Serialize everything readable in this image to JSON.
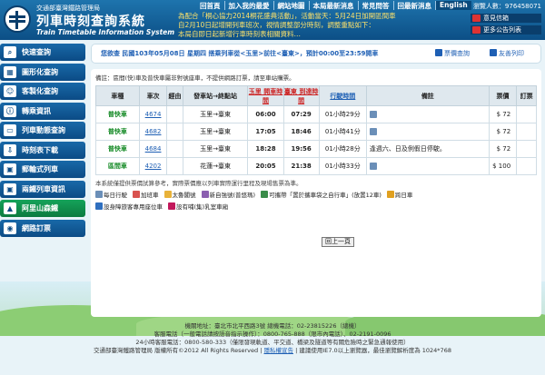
{
  "header": {
    "agency": "交通部臺灣鐵路管理局",
    "title_cn": "列車時刻查詢系統",
    "title_en": "Train Timetable Information System",
    "nav": [
      "回首頁",
      "加入我的最愛",
      "網站地圖",
      "本局最新消息",
      "常見問答",
      "回最新消息",
      "English"
    ],
    "visitor": "瀏覽人數：976458071",
    "marquee": [
      "為配合「桐心協力2014桐花盛典活動」，活動當天：5月24日加開區間車",
      "自2月10日起增開列車班次，視情調整部分時刻，調整重點如下：",
      "本局自即日起新增行車時刻表相關資料…"
    ],
    "side_buttons": [
      "意見信箱",
      "更多公告列表"
    ]
  },
  "sidebar": [
    {
      "icon": "search-icon",
      "label": "快速查詢"
    },
    {
      "icon": "chart-icon",
      "label": "圖形化查詢"
    },
    {
      "icon": "user-icon",
      "label": "客製化查詢"
    },
    {
      "icon": "info-icon",
      "label": "轉乘資訊"
    },
    {
      "icon": "monitor-icon",
      "label": "列車動態查詢"
    },
    {
      "icon": "download-icon",
      "label": "時刻表下載"
    },
    {
      "icon": "train-icon",
      "label": "郵輪式列車"
    },
    {
      "icon": "train-icon",
      "label": "兩鐵列車資訊"
    },
    {
      "icon": "mountain-icon",
      "label": "阿里山森鐵"
    },
    {
      "icon": "ticket-icon",
      "label": "網路訂票"
    }
  ],
  "info_bar": {
    "text": "您欲查 民國103年05月08日 星期四 搭乘列車從<玉里>前往<臺東>，預計00:00至23:59開車",
    "tool1": "票價查詢",
    "tool2": "友善列印"
  },
  "note": "備註：區間(快)車及普快車屬非對號座車，不提供網路訂票，請至車站購票。",
  "table": {
    "headers": [
      "車種",
      "車次",
      "經由",
      "發車站→終點站",
      "玉里 開車時間",
      "臺東 到達時間",
      "行駛時間",
      "備註",
      "票價",
      "訂票"
    ],
    "rows": [
      {
        "type": "普快車",
        "train": "4674",
        "route": "玉里→臺東",
        "dep": "06:00",
        "arr": "07:29",
        "dur": "01小時29分",
        "note": "",
        "price": "$ 72"
      },
      {
        "type": "普快車",
        "train": "4682",
        "route": "玉里→臺東",
        "dep": "17:05",
        "arr": "18:46",
        "dur": "01小時41分",
        "note": "",
        "price": "$ 72"
      },
      {
        "type": "普快車",
        "train": "4684",
        "route": "玉里→臺東",
        "dep": "18:28",
        "arr": "19:56",
        "dur": "01小時28分",
        "note": "逢週六、日及例假日停駛。",
        "price": "$ 72"
      },
      {
        "type": "區間車",
        "train": "4202",
        "route": "花蓮→臺東",
        "dep": "20:05",
        "arr": "21:38",
        "dur": "01小時33分",
        "note": "",
        "price": "$ 100"
      }
    ]
  },
  "legend_note": "本系統僅提供票價試算參考，實際票價應以列車實際運行里程及現場售票為準。",
  "legend": [
    "每日行駛",
    "加班車",
    "太魯閣號",
    "新自強號(普悠瑪)",
    "可攜帶「置於攜車袋之自行車」(放置12車)",
    "跨日車",
    "設身障旅客專用座位車",
    "設有哺(集)乳室車廂"
  ],
  "back_button": "回上一頁",
  "footer": {
    "line1": "機關地址：臺北市北平西路3號 總機電話：02-23815226（總機）",
    "line2": "客服電話（一般電話請按語音指示操作）：0800-765-888（限市內電話）、02-2191-0096",
    "line3": "24小時客服電話：0800-580-333（僅限發現軌道、平交道、橋梁及隧道等有關危險時之緊急通報使用）",
    "line4_a": "交通部臺灣鐵路管理局  版權所有©2012 All Rights Reserved |",
    "line4_link": "隱私權宣告",
    "line4_b": "| 建議使用IE7.0以上瀏覽器，最佳瀏覽解析度為 1024*768"
  }
}
